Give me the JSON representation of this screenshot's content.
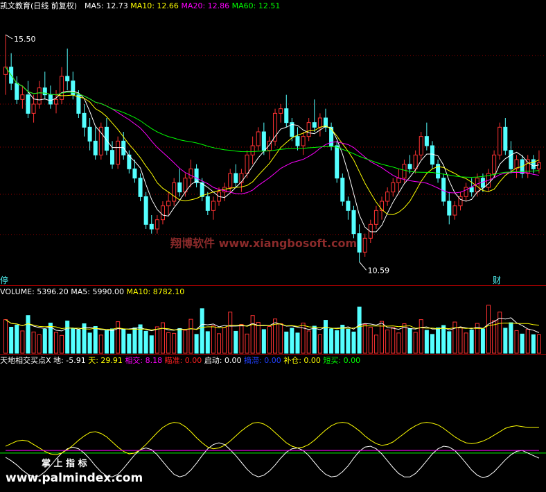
{
  "title": "凯文教育(日线 前复权)",
  "main_legend": [
    {
      "label": "MA5: 12.73",
      "color": "#ffffff"
    },
    {
      "label": "MA10: 12.66",
      "color": "#ffff00"
    },
    {
      "label": "MA20: 12.86",
      "color": "#ff00ff"
    },
    {
      "label": "MA60: 12.51",
      "color": "#00ff00"
    }
  ],
  "high_label": "15.50",
  "low_label": "10.59",
  "watermark": "翔博软件 www.xiangbosoft.com",
  "left_tag": "停",
  "right_tag": "财",
  "volume_legend": [
    {
      "label": "VOLUME: 5396.20",
      "color": "#ffffff"
    },
    {
      "label": "MA5: 5990.00",
      "color": "#ffffff"
    },
    {
      "label": "MA10: 8782.10",
      "color": "#ffff00"
    }
  ],
  "indicator_legend": [
    {
      "label": "天地相交买点X 地: -5.91",
      "color": "#ffffff"
    },
    {
      "label": "天: 29.91",
      "color": "#ffff00"
    },
    {
      "label": "相交: 8.18",
      "color": "#ff00ff"
    },
    {
      "label": "瞄准: 0.00",
      "color": "#ff2020"
    },
    {
      "label": "启动: 0.00",
      "color": "#ffffff"
    },
    {
      "label": "摘滞: 0.00",
      "color": "#2040ff"
    },
    {
      "label": "补仓: 0.00",
      "color": "#ffff00"
    },
    {
      "label": "短买: 0.00",
      "color": "#00ff00"
    }
  ],
  "bottom_brand": "掌 上 指 标",
  "bottom_url": "www.palmindex.com",
  "colors": {
    "up": "#ff3232",
    "down": "#54ffff",
    "ma5": "#ffffff",
    "ma10": "#ffff00",
    "ma20": "#ff00ff",
    "ma60": "#00ff00",
    "grid": "#a00000"
  },
  "chart_data": [
    {
      "type": "candlestick",
      "name": "price",
      "ylim": [
        10.4,
        15.8
      ],
      "ohlc": [
        [
          14.64,
          15.5,
          14.2,
          14.8
        ],
        [
          14.8,
          15.1,
          14.3,
          14.45
        ],
        [
          14.45,
          14.6,
          14.0,
          14.1
        ],
        [
          14.1,
          14.4,
          13.9,
          14.2
        ],
        [
          14.2,
          14.5,
          13.7,
          13.8
        ],
        [
          13.8,
          14.2,
          13.6,
          14.0
        ],
        [
          14.0,
          14.5,
          13.9,
          14.35
        ],
        [
          14.35,
          14.7,
          14.1,
          14.2
        ],
        [
          14.2,
          14.4,
          13.9,
          14.0
        ],
        [
          14.0,
          14.3,
          13.8,
          14.1
        ],
        [
          14.1,
          14.8,
          14.0,
          14.6
        ],
        [
          14.6,
          15.2,
          14.3,
          14.5
        ],
        [
          14.5,
          14.7,
          14.1,
          14.2
        ],
        [
          14.2,
          14.3,
          13.7,
          13.8
        ],
        [
          13.8,
          14.0,
          13.3,
          13.5
        ],
        [
          13.5,
          13.7,
          13.0,
          13.2
        ],
        [
          13.2,
          13.5,
          12.8,
          12.9
        ],
        [
          12.9,
          13.6,
          12.8,
          13.5
        ],
        [
          13.5,
          13.7,
          12.9,
          13.0
        ],
        [
          13.0,
          13.2,
          12.6,
          12.7
        ],
        [
          12.7,
          13.3,
          12.6,
          13.2
        ],
        [
          13.2,
          13.4,
          12.8,
          12.9
        ],
        [
          12.9,
          13.0,
          12.5,
          12.6
        ],
        [
          12.6,
          12.8,
          12.3,
          12.4
        ],
        [
          12.4,
          12.5,
          11.9,
          12.0
        ],
        [
          12.0,
          12.1,
          11.3,
          11.4
        ],
        [
          11.4,
          11.6,
          11.2,
          11.3
        ],
        [
          11.3,
          11.6,
          11.2,
          11.5
        ],
        [
          11.5,
          11.9,
          11.4,
          11.8
        ],
        [
          11.8,
          12.1,
          11.6,
          11.9
        ],
        [
          11.9,
          12.4,
          11.8,
          12.3
        ],
        [
          12.3,
          12.6,
          12.0,
          12.1
        ],
        [
          12.1,
          12.5,
          12.0,
          12.4
        ],
        [
          12.4,
          12.8,
          12.2,
          12.6
        ],
        [
          12.6,
          12.7,
          12.2,
          12.3
        ],
        [
          12.3,
          12.4,
          11.9,
          12.0
        ],
        [
          12.0,
          12.1,
          11.6,
          11.7
        ],
        [
          11.7,
          12.0,
          11.5,
          11.9
        ],
        [
          11.9,
          12.2,
          11.8,
          12.1
        ],
        [
          12.1,
          12.3,
          11.9,
          12.2
        ],
        [
          12.2,
          12.6,
          12.1,
          12.5
        ],
        [
          12.5,
          12.7,
          12.2,
          12.3
        ],
        [
          12.3,
          12.6,
          12.1,
          12.5
        ],
        [
          12.5,
          13.0,
          12.4,
          12.9
        ],
        [
          12.9,
          13.3,
          12.7,
          13.1
        ],
        [
          13.1,
          13.5,
          13.0,
          13.4
        ],
        [
          13.4,
          13.6,
          12.9,
          13.0
        ],
        [
          13.0,
          13.3,
          12.8,
          13.2
        ],
        [
          13.2,
          13.9,
          13.1,
          13.8
        ],
        [
          13.8,
          14.0,
          13.6,
          13.9
        ],
        [
          13.9,
          14.2,
          13.5,
          13.6
        ],
        [
          13.6,
          13.7,
          13.2,
          13.3
        ],
        [
          13.3,
          13.5,
          13.0,
          13.1
        ],
        [
          13.1,
          13.4,
          12.9,
          13.3
        ],
        [
          13.3,
          13.7,
          13.2,
          13.6
        ],
        [
          13.6,
          14.1,
          13.4,
          13.5
        ],
        [
          13.5,
          13.8,
          13.3,
          13.7
        ],
        [
          13.7,
          13.9,
          13.4,
          13.5
        ],
        [
          13.5,
          13.6,
          13.0,
          13.1
        ],
        [
          13.1,
          13.2,
          12.3,
          12.4
        ],
        [
          12.4,
          12.5,
          11.8,
          11.9
        ],
        [
          11.9,
          12.0,
          11.5,
          11.7
        ],
        [
          11.7,
          11.8,
          11.1,
          11.2
        ],
        [
          11.2,
          11.4,
          10.59,
          10.8
        ],
        [
          10.8,
          11.2,
          10.7,
          11.1
        ],
        [
          11.1,
          11.5,
          11.0,
          11.4
        ],
        [
          11.4,
          11.8,
          11.3,
          11.7
        ],
        [
          11.7,
          12.0,
          11.5,
          11.9
        ],
        [
          11.9,
          12.2,
          11.8,
          12.1
        ],
        [
          12.1,
          12.4,
          12.0,
          12.3
        ],
        [
          12.3,
          12.6,
          12.1,
          12.4
        ],
        [
          12.4,
          12.8,
          12.3,
          12.7
        ],
        [
          12.7,
          12.9,
          12.5,
          12.6
        ],
        [
          12.6,
          13.0,
          12.5,
          12.9
        ],
        [
          12.9,
          13.4,
          12.8,
          13.3
        ],
        [
          13.3,
          13.6,
          13.0,
          13.1
        ],
        [
          13.1,
          13.2,
          12.6,
          12.7
        ],
        [
          12.7,
          12.8,
          12.3,
          12.4
        ],
        [
          12.4,
          12.5,
          11.8,
          11.9
        ],
        [
          11.9,
          12.1,
          11.4,
          11.6
        ],
        [
          11.6,
          11.9,
          11.5,
          11.8
        ],
        [
          11.8,
          12.1,
          11.7,
          12.0
        ],
        [
          12.0,
          12.3,
          11.9,
          12.2
        ],
        [
          12.2,
          12.4,
          12.0,
          12.1
        ],
        [
          12.1,
          12.5,
          12.0,
          12.4
        ],
        [
          12.4,
          12.5,
          12.1,
          12.2
        ],
        [
          12.2,
          12.6,
          12.1,
          12.5
        ],
        [
          12.5,
          13.0,
          12.4,
          12.9
        ],
        [
          12.9,
          13.6,
          12.8,
          13.5
        ],
        [
          13.5,
          13.7,
          12.9,
          13.0
        ],
        [
          13.0,
          13.2,
          12.5,
          12.6
        ],
        [
          12.6,
          12.9,
          12.4,
          12.8
        ],
        [
          12.8,
          12.9,
          12.4,
          12.5
        ],
        [
          12.5,
          12.9,
          12.4,
          12.8
        ],
        [
          12.8,
          12.9,
          12.5,
          12.6
        ],
        [
          12.6,
          13.0,
          12.5,
          12.73
        ]
      ]
    },
    {
      "type": "bar",
      "name": "VOLUME",
      "ylim": [
        0,
        16000
      ],
      "values": [
        9800,
        7600,
        8200,
        6500,
        11000,
        6200,
        5400,
        7000,
        8800,
        6100,
        5200,
        9400,
        7300,
        6800,
        8600,
        5900,
        7800,
        5300,
        6600,
        7100,
        9200,
        6900,
        5600,
        7400,
        8300,
        6400,
        5100,
        7700,
        8900,
        6000,
        5800,
        7200,
        6700,
        9900,
        5500,
        13000,
        6300,
        8000,
        5700,
        7500,
        12000,
        6400,
        8400,
        5600,
        11000,
        9000,
        6900,
        7800,
        10000,
        8600,
        6200,
        7300,
        5900,
        8800,
        6500,
        7900,
        5400,
        9600,
        7100,
        6600,
        8200,
        7000,
        6200,
        13500,
        8400,
        7600,
        5300,
        9300,
        6800,
        7500,
        5900,
        8600,
        7200,
        6100,
        9800,
        6700,
        5500,
        7400,
        8100,
        6300,
        9100,
        7600,
        5900,
        6800,
        8700,
        7100,
        14000,
        9500,
        12000,
        7300,
        8900,
        6600,
        5600,
        7000,
        5400,
        5396
      ]
    },
    {
      "type": "line",
      "name": "indicator",
      "ylim": [
        -40,
        100
      ],
      "series": [
        {
          "name": "地",
          "values": [
            -5,
            -9,
            -14,
            -20,
            -25,
            -28,
            -27,
            -22,
            -15,
            -7,
            0,
            5,
            7,
            5,
            0,
            -7,
            -15,
            -22,
            -27,
            -28,
            -25,
            -18,
            -10,
            -2,
            4,
            6,
            4,
            -2,
            -10,
            -18,
            -25,
            -28,
            -26,
            -20,
            -12,
            -3,
            5,
            10,
            12,
            10,
            4,
            -3,
            -11,
            -19,
            -25,
            -28,
            -26,
            -21,
            -14,
            -6,
            1,
            5,
            6,
            3,
            -3,
            -11,
            -19,
            -25,
            -28,
            -27,
            -22,
            -15,
            -6,
            2,
            7,
            8,
            5,
            -1,
            -9,
            -17,
            -24,
            -28,
            -28,
            -24,
            -17,
            -9,
            -1,
            5,
            8,
            7,
            3,
            -4,
            -12,
            -20,
            -26,
            -29,
            -27,
            -22,
            -15,
            -8,
            -2,
            2,
            3,
            0,
            -3,
            -6
          ]
        },
        {
          "name": "天",
          "values": [
            8,
            11,
            14,
            15,
            14,
            10,
            6,
            2,
            -1,
            -2,
            0,
            4,
            9,
            15,
            20,
            24,
            25,
            23,
            19,
            13,
            7,
            2,
            -1,
            0,
            4,
            10,
            17,
            24,
            30,
            34,
            36,
            35,
            31,
            25,
            18,
            12,
            7,
            5,
            6,
            9,
            14,
            20,
            26,
            31,
            35,
            36,
            34,
            30,
            24,
            18,
            12,
            8,
            6,
            7,
            10,
            15,
            21,
            27,
            32,
            35,
            36,
            35,
            31,
            26,
            20,
            15,
            11,
            9,
            10,
            13,
            18,
            23,
            28,
            32,
            35,
            36,
            35,
            33,
            29,
            24,
            19,
            15,
            12,
            11,
            12,
            14,
            17,
            21,
            25,
            29,
            31,
            32,
            31,
            30,
            30,
            30
          ]
        },
        {
          "name": "相交",
          "values": [
            3,
            3,
            3,
            3,
            3,
            3,
            3,
            3,
            3,
            3,
            3,
            3,
            3,
            3,
            3,
            3,
            3,
            3,
            3,
            3,
            3,
            3,
            3,
            3,
            3,
            3,
            3,
            3,
            3,
            3,
            3,
            3,
            3,
            3,
            3,
            3,
            3,
            3,
            3,
            3,
            3,
            3,
            3,
            3,
            3,
            3,
            3,
            3,
            3,
            3,
            3,
            3,
            3,
            3,
            3,
            3,
            3,
            3,
            3,
            3,
            3,
            3,
            3,
            3,
            3,
            3,
            3,
            3,
            3,
            3,
            3,
            3,
            3,
            3,
            3,
            3,
            3,
            3,
            3,
            3,
            3,
            3,
            3,
            3,
            3,
            3,
            3,
            3,
            3,
            3,
            3,
            3,
            3,
            3,
            3,
            3
          ]
        }
      ]
    }
  ]
}
